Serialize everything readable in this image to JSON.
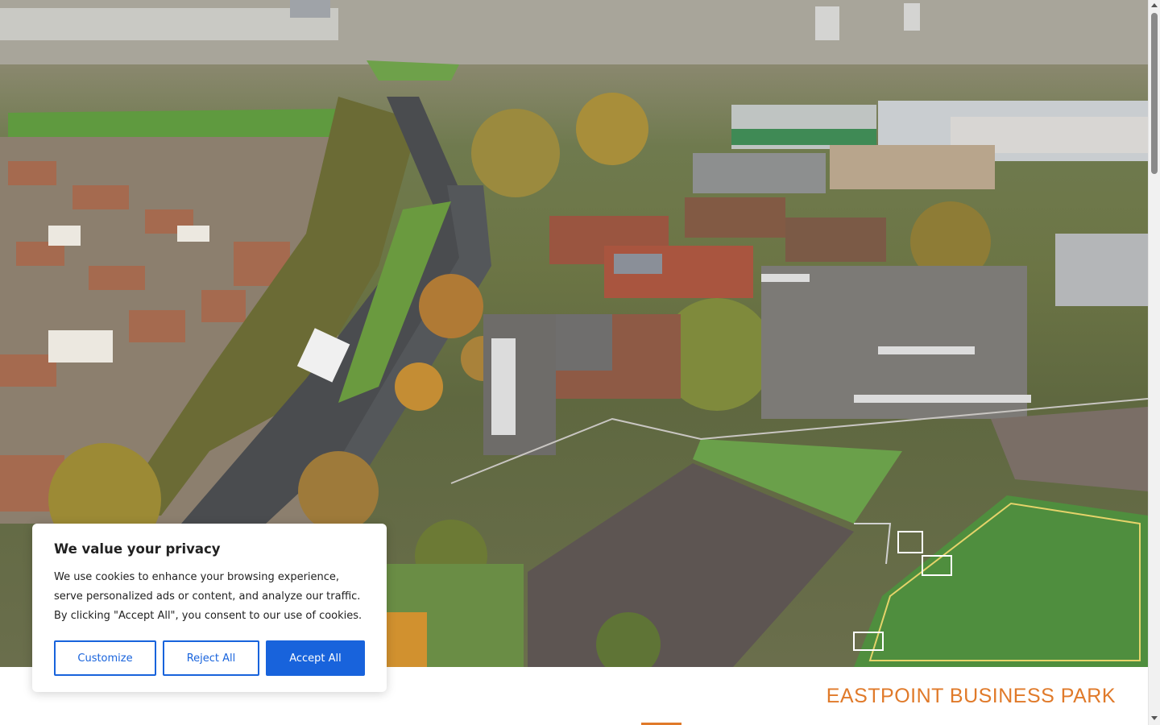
{
  "hero": {
    "image_description_icon": "aerial-photo-icon"
  },
  "heading": {
    "title": "EASTPOINT BUSINESS PARK"
  },
  "cookie_banner": {
    "title": "We value your privacy",
    "body": "We use cookies to enhance your browsing experience, serve personalized ads or content, and analyze our traffic. By clicking \"Accept All\", you consent to our use of cookies.",
    "customize_label": "Customize",
    "reject_label": "Reject All",
    "accept_label": "Accept All"
  },
  "colors": {
    "accent": "#e07a2a",
    "button_blue": "#1863dc"
  }
}
